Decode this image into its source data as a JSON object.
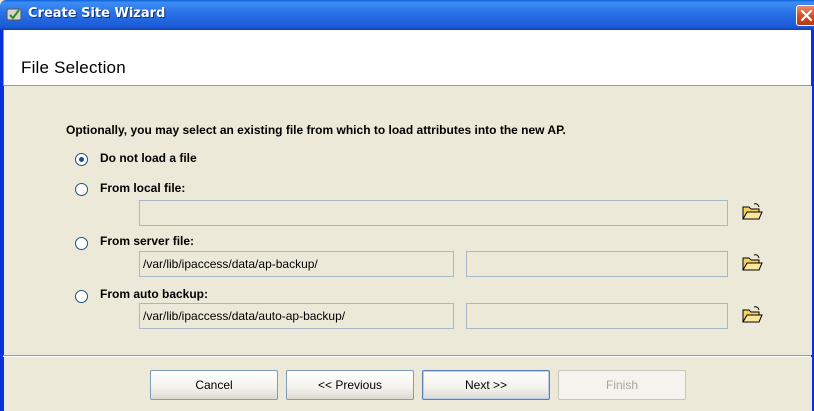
{
  "window": {
    "title": "Create Site Wizard"
  },
  "header": {
    "title": "File Selection"
  },
  "content": {
    "intro": "Optionally, you may select an existing file from which to load attributes into the new AP.",
    "options": [
      {
        "label": "Do not load a file",
        "selected": true
      },
      {
        "label": "From local file:",
        "selected": false,
        "path": ""
      },
      {
        "label": "From server file:",
        "selected": false,
        "path": "/var/lib/ipaccess/data/ap-backup/",
        "file": ""
      },
      {
        "label": "From auto backup:",
        "selected": false,
        "path": "/var/lib/ipaccess/data/auto-ap-backup/",
        "file": ""
      }
    ]
  },
  "footer": {
    "cancel": "Cancel",
    "previous": "<< Previous",
    "next": "Next >>",
    "finish": "Finish"
  },
  "icons": [
    "app-icon",
    "close-icon",
    "open-folder-icon"
  ],
  "colors": {
    "titlebar": "#2a74e8",
    "window_bg": "#ece9d8",
    "close_button": "#d0461f"
  }
}
